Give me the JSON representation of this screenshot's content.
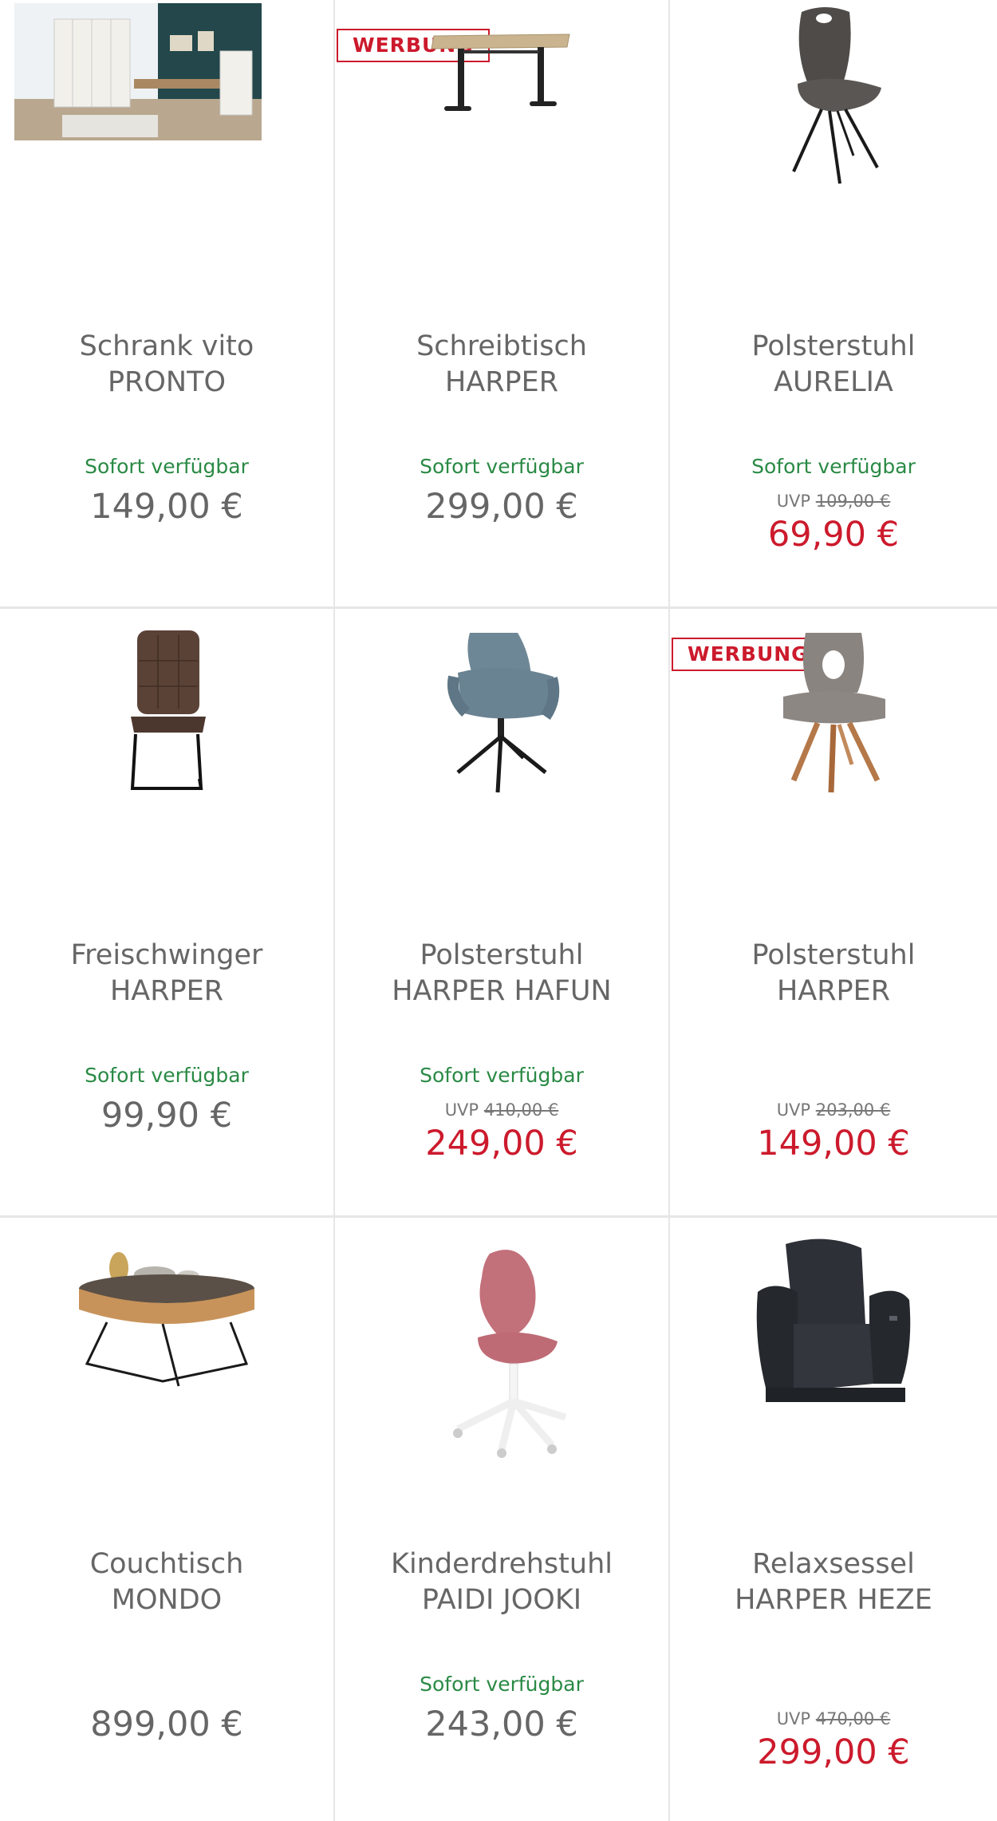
{
  "colors": {
    "availability": "#2a8a45",
    "sale_price": "#cc1a2c",
    "badge": "#cc1a2c",
    "text": "#666666",
    "divider": "#e6e6e6"
  },
  "products": [
    {
      "badge": "",
      "image": "office-furniture-room-image",
      "title_line1": "Schrank vito",
      "title_line2": "PRONTO",
      "availability": "Sofort verfügbar",
      "uvp_label": "",
      "uvp_price": "",
      "price": "149,00 €"
    },
    {
      "badge": "WERBUNG",
      "image": "standing-desk-image",
      "title_line1": "Schreibtisch",
      "title_line2": "HARPER",
      "availability": "Sofort verfügbar",
      "uvp_label": "",
      "uvp_price": "",
      "price": "299,00 €"
    },
    {
      "badge": "",
      "image": "upholstered-chair-image",
      "title_line1": "Polsterstuhl",
      "title_line2": "AURELIA",
      "availability": "Sofort verfügbar",
      "uvp_label": "UVP",
      "uvp_price": "109,00 €",
      "price": "69,90 €"
    },
    {
      "badge": "",
      "image": "cantilever-chair-image",
      "title_line1": "Freischwinger",
      "title_line2": "HARPER",
      "availability": "Sofort verfügbar",
      "uvp_label": "",
      "uvp_price": "",
      "price": "99,90 €"
    },
    {
      "badge": "",
      "image": "armchair-blue-image",
      "title_line1": "Polsterstuhl",
      "title_line2": "HARPER HAFUN",
      "availability": "Sofort verfügbar",
      "uvp_label": "UVP",
      "uvp_price": "410,00 €",
      "price": "249,00 €"
    },
    {
      "badge": "WERBUNG",
      "image": "chair-wood-legs-image",
      "title_line1": "Polsterstuhl",
      "title_line2": "HARPER",
      "availability": "",
      "uvp_label": "UVP",
      "uvp_price": "203,00 €",
      "price": "149,00 €"
    },
    {
      "badge": "",
      "image": "coffee-table-image",
      "title_line1": "Couchtisch",
      "title_line2": "MONDO",
      "availability": "",
      "uvp_label": "",
      "uvp_price": "",
      "price": "899,00 €"
    },
    {
      "badge": "",
      "image": "kids-desk-chair-image",
      "title_line1": "Kinderdrehstuhl",
      "title_line2": "PAIDI JOOKI",
      "availability": "Sofort verfügbar",
      "uvp_label": "",
      "uvp_price": "",
      "price": "243,00 €"
    },
    {
      "badge": "",
      "image": "recliner-armchair-image",
      "title_line1": "Relaxsessel",
      "title_line2": "HARPER HEZE",
      "availability": "",
      "uvp_label": "UVP",
      "uvp_price": "470,00 €",
      "price": "299,00 €"
    }
  ]
}
